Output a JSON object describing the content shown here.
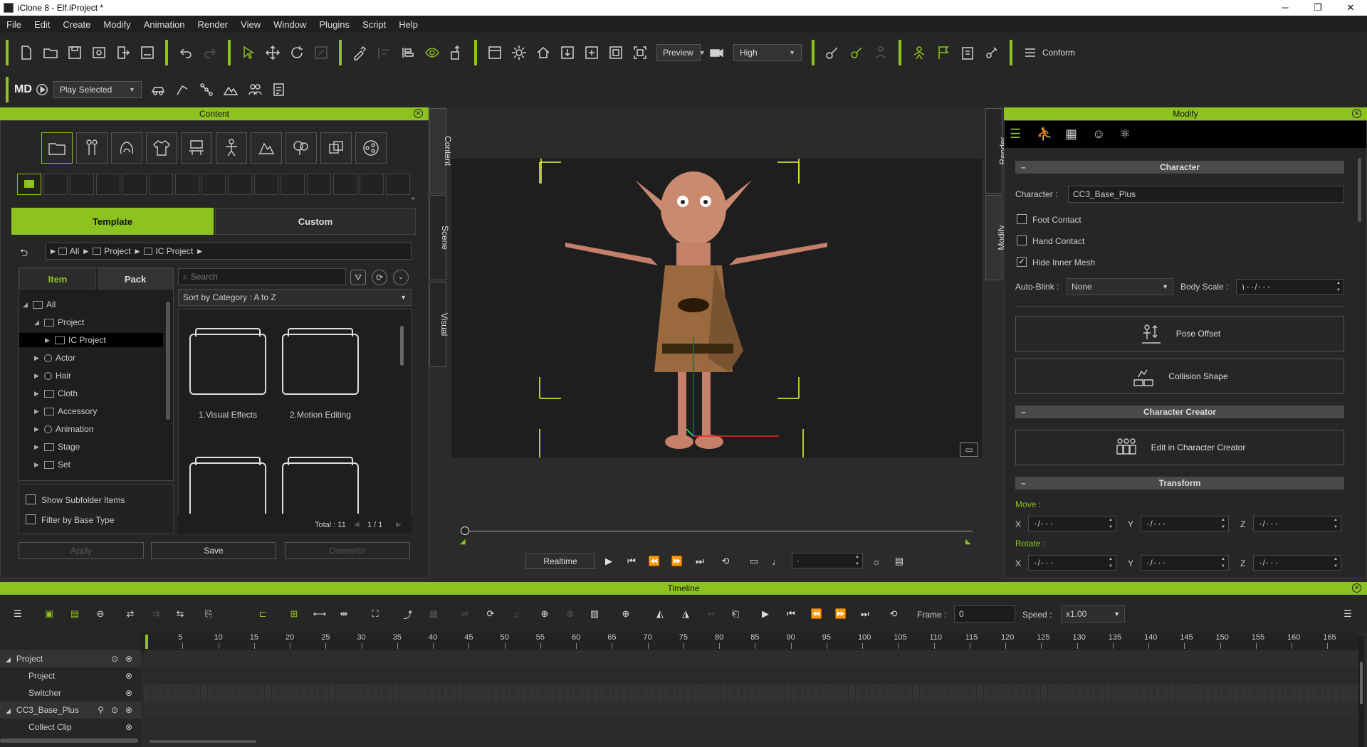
{
  "window": {
    "title": "iClone 8 - Elf.iProject *",
    "minimize": "─",
    "maximize": "❐",
    "close": "✕"
  },
  "menu": [
    "File",
    "Edit",
    "Create",
    "Modify",
    "Animation",
    "Render",
    "View",
    "Window",
    "Plugins",
    "Script",
    "Help"
  ],
  "toolbar": {
    "preview_mode": "Preview",
    "quality": "High",
    "conform_label": "Conform",
    "play_mode": "Play Selected",
    "md_logo": "MD"
  },
  "content_panel": {
    "title": "Content",
    "tabs": {
      "template": "Template",
      "custom": "Custom"
    },
    "breadcrumb": [
      "All",
      "Project",
      "IC Project"
    ],
    "subtabs": {
      "item": "Item",
      "pack": "Pack"
    },
    "search_placeholder": "Search",
    "sort": "Sort by Category : A to Z",
    "tree": [
      {
        "label": "All",
        "expanded": true
      },
      {
        "label": "Project",
        "expanded": true
      },
      {
        "label": "IC Project",
        "selected": true
      },
      {
        "label": "Actor"
      },
      {
        "label": "Hair"
      },
      {
        "label": "Cloth"
      },
      {
        "label": "Accessory"
      },
      {
        "label": "Animation"
      },
      {
        "label": "Stage"
      },
      {
        "label": "Set"
      }
    ],
    "folders": [
      "1.Visual Effects",
      "2.Motion Editing"
    ],
    "total": "Total : 11",
    "page": "1 / 1",
    "show_subfolder": "Show Subfolder Items",
    "filter_base": "Filter by Base Type",
    "buttons": {
      "apply": "Apply",
      "save": "Save",
      "overwrite": "Overwrite"
    },
    "side_tabs": [
      "Content",
      "Scene",
      "Visual"
    ]
  },
  "viewport": {
    "playback_mode": "Realtime",
    "frame_field": "·"
  },
  "modify_panel": {
    "title": "Modify",
    "side_tabs": [
      "Render",
      "Modify"
    ],
    "sections": {
      "character": "Character",
      "cc": "Character Creator",
      "transform": "Transform"
    },
    "character_label": "Character :",
    "character_value": "CC3_Base_Plus",
    "foot_contact": "Foot Contact",
    "hand_contact": "Hand Contact",
    "hide_inner_mesh": "Hide Inner Mesh",
    "auto_blink_label": "Auto-Blink :",
    "auto_blink_value": "None",
    "body_scale_label": "Body Scale :",
    "body_scale_value": "١٠٠/٠٠٠",
    "pose_offset": "Pose Offset",
    "collision_shape": "Collision Shape",
    "edit_cc": "Edit in Character Creator",
    "move_label": "Move :",
    "rotate_label": "Rotate :",
    "axes": [
      "X",
      "Y",
      "Z"
    ],
    "move_values": [
      "٠/٠٠٠",
      "٠/٠٠٠",
      "٠/٠٠٠"
    ],
    "rotate_values": [
      "٠/٠٠٠",
      "٠/٠٠٠",
      "٠/٠٠٠"
    ]
  },
  "timeline": {
    "title": "Timeline",
    "frame_label": "Frame :",
    "frame_value": "0",
    "speed_label": "Speed :",
    "speed_value": "x1.00",
    "ticks": [
      5,
      10,
      15,
      20,
      25,
      30,
      35,
      40,
      45,
      50,
      55,
      60,
      65,
      70,
      75,
      80,
      85,
      90,
      95,
      100,
      105,
      110,
      115,
      120,
      125,
      130,
      135,
      140,
      145,
      150,
      155,
      160,
      165
    ],
    "tracks": [
      {
        "label": "Project",
        "group": true
      },
      {
        "label": "Project"
      },
      {
        "label": "Switcher"
      },
      {
        "label": "CC3_Base_Plus",
        "group": true
      },
      {
        "label": "Collect Clip"
      }
    ]
  },
  "colors": {
    "accent": "#8dc21f",
    "panel": "#262626",
    "viewport": "#1e1e1e"
  }
}
